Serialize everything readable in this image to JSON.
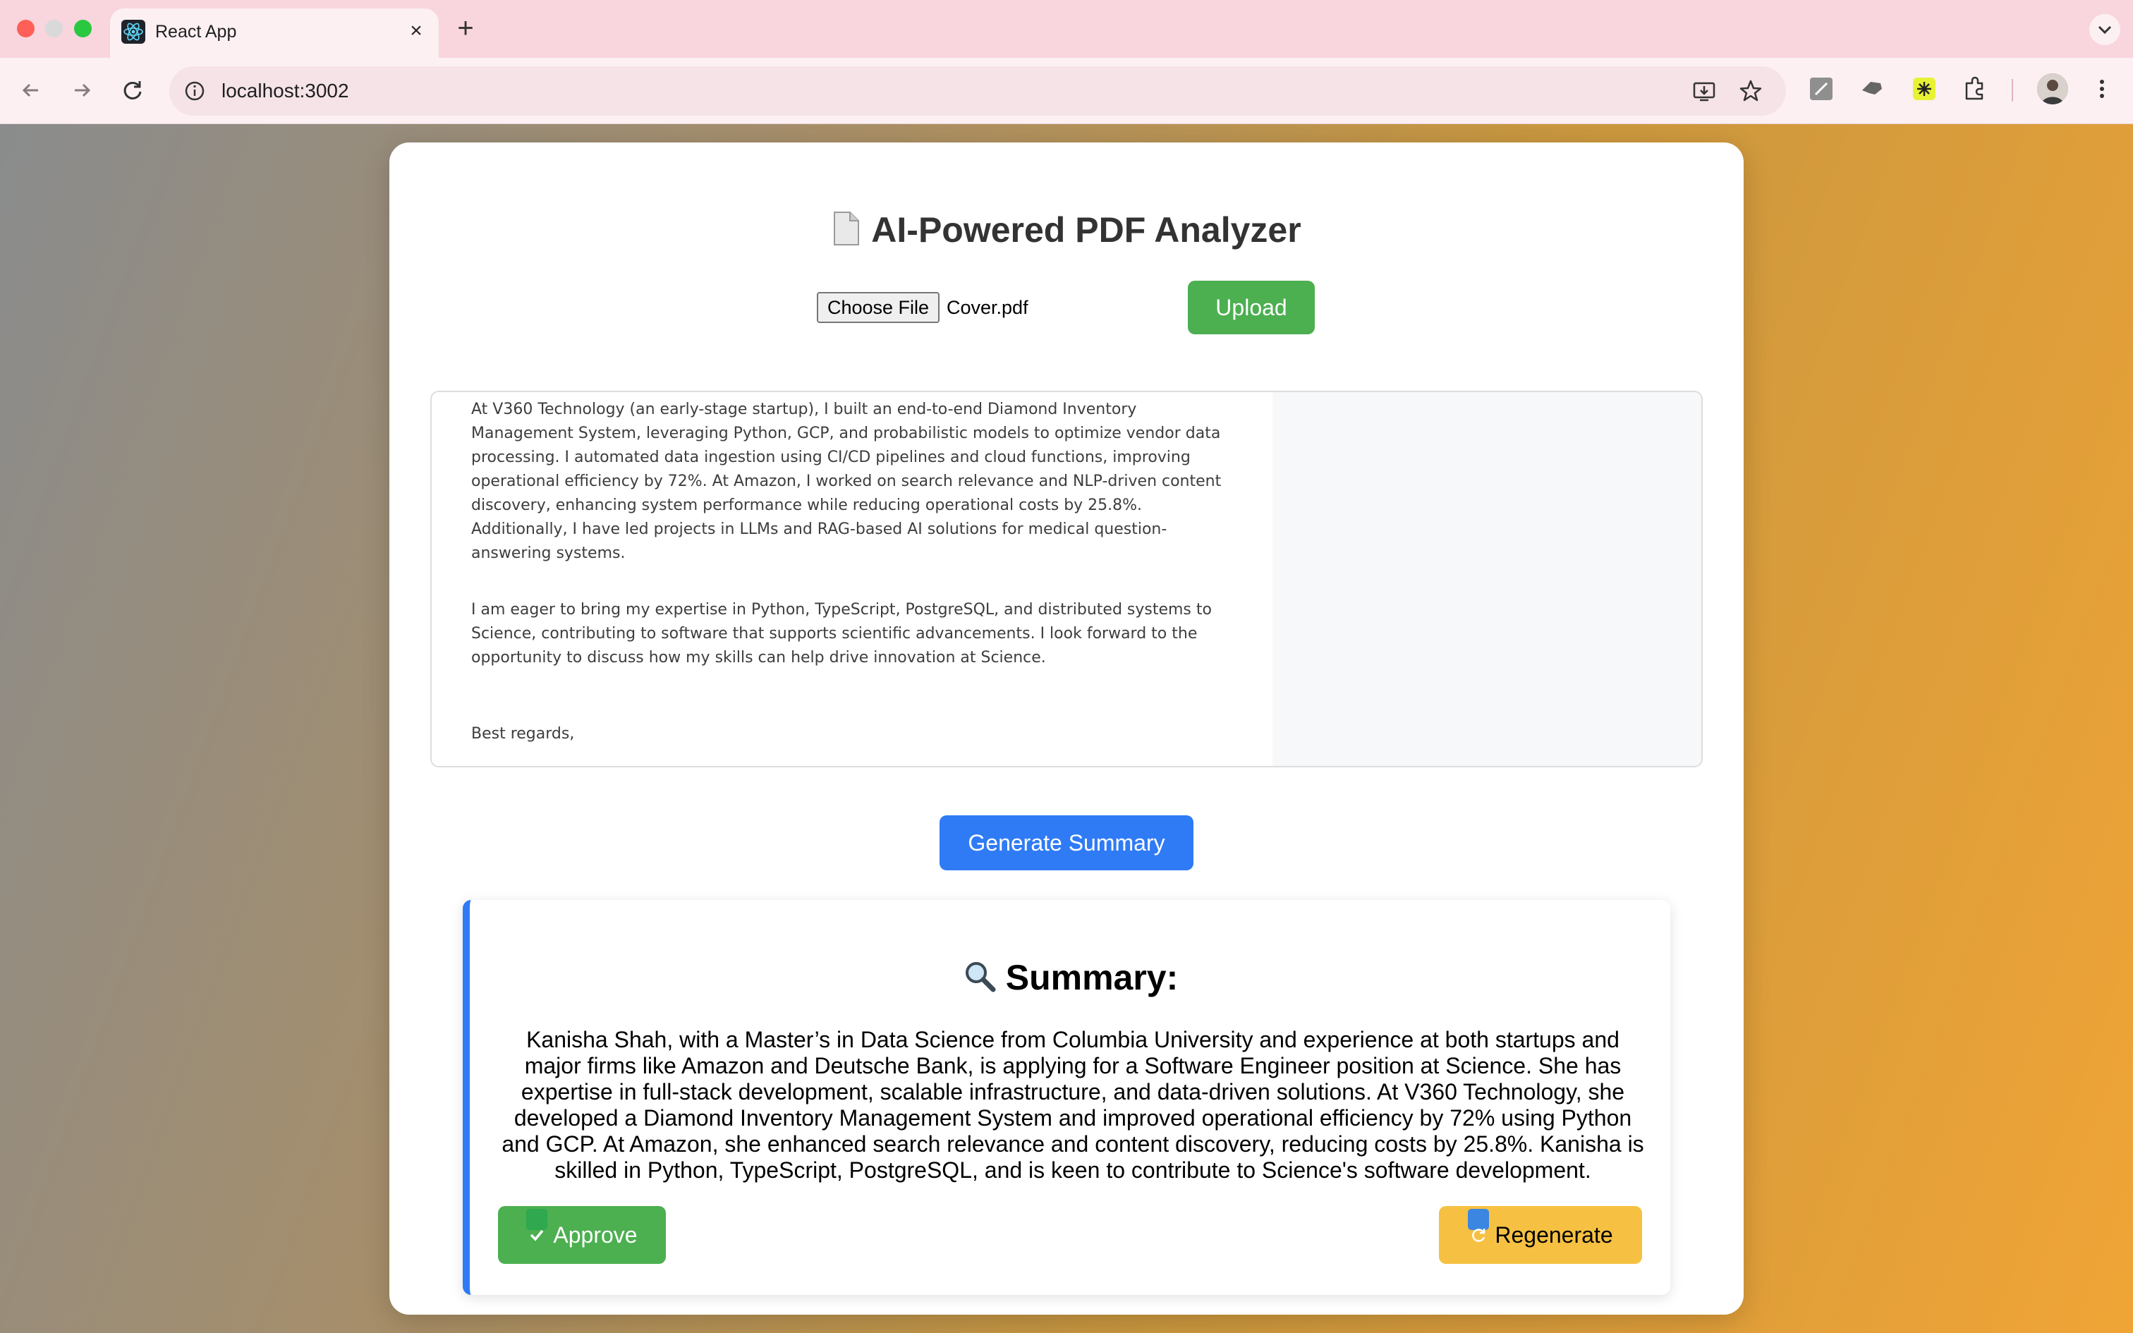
{
  "browser": {
    "tab_title": "React App",
    "url": "localhost:3002"
  },
  "app": {
    "title": "AI-Powered PDF Analyzer",
    "choose_file_label": "Choose File",
    "file_name": "Cover.pdf",
    "upload_label": "Upload",
    "generate_label": "Generate Summary"
  },
  "pdf": {
    "paragraphs": [
      "At V360 Technology (an early-stage startup), I built an end-to-end Diamond Inventory Management System, leveraging Python, GCP, and probabilistic models to optimize vendor data processing. I automated data ingestion using CI/CD pipelines and cloud functions, improving operational efficiency by 72%. At Amazon, I worked on search relevance and NLP-driven content discovery, enhancing system performance while reducing operational costs by 25.8%. Additionally, I have led projects in LLMs and RAG-based AI solutions for medical question-answering systems.",
      "I am eager to bring my expertise in Python, TypeScript, PostgreSQL, and distributed systems to Science, contributing to software that supports scientific advancements. I look forward to the opportunity to discuss how my skills can help drive innovation at Science.",
      "Best regards,"
    ]
  },
  "summary": {
    "heading": "Summary:",
    "text": "Kanisha Shah, with a Master’s in Data Science from Columbia University and experience at both startups and major firms like Amazon and Deutsche Bank, is applying for a Software Engineer position at Science. She has expertise in full-stack development, scalable infrastructure, and data-driven solutions. At V360 Technology, she developed a Diamond Inventory Management System and improved operational efficiency by 72% using Python and GCP. At Amazon, she enhanced search relevance and content discovery, reducing costs by 25.8%. Kanisha is skilled in Python, TypeScript, PostgreSQL, and is keen to contribute to Science's software development.",
    "approve_label": "Approve",
    "regenerate_label": "Regenerate"
  },
  "colors": {
    "upload": "#4caf50",
    "generate": "#2f7bf5",
    "approve": "#4caf50",
    "regenerate": "#f6c142"
  },
  "icons": [
    "react-favicon",
    "close-icon",
    "plus-icon",
    "chevron-down-icon",
    "back-icon",
    "forward-icon",
    "reload-icon",
    "site-info-icon",
    "install-icon",
    "star-icon",
    "extension-icon",
    "puzzle-icon",
    "kebab-menu-icon",
    "document-emoji-icon",
    "magnifier-emoji-icon",
    "check-emoji-icon",
    "refresh-emoji-icon"
  ]
}
